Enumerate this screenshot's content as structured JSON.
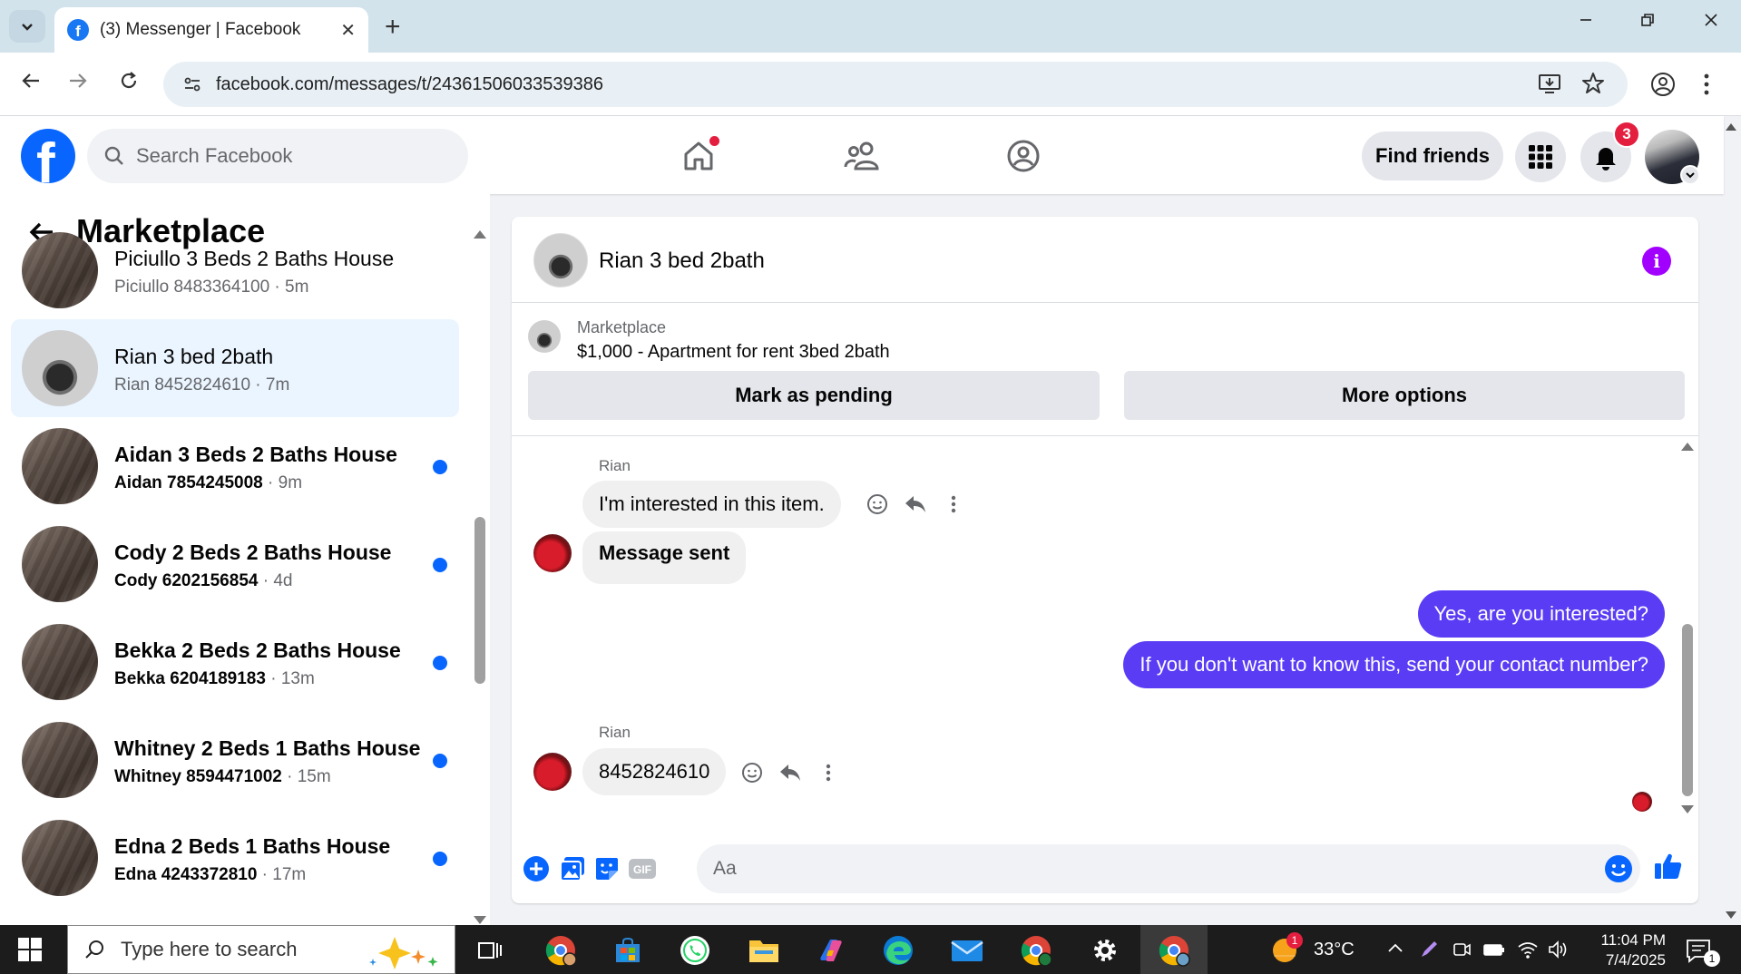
{
  "browser": {
    "tab_title": "(3) Messenger | Facebook",
    "url": "facebook.com/messages/t/24361506033539386",
    "new_tab_label": "+",
    "tab_close_label": "✕"
  },
  "header": {
    "logo_letter": "f",
    "search_placeholder": "Search Facebook",
    "find_friends_label": "Find friends",
    "notification_count": "3"
  },
  "sidebar": {
    "title": "Marketplace",
    "conversations": [
      {
        "name": "Piciullo 3 Beds 2 Baths House",
        "contact": "Piciullo 8483364100",
        "time": "5m",
        "unread": false,
        "active": false
      },
      {
        "name": "Rian 3 bed 2bath",
        "contact": "Rian 8452824610",
        "time": "7m",
        "unread": false,
        "active": true
      },
      {
        "name": "Aidan 3 Beds 2 Baths House",
        "contact": "Aidan 7854245008",
        "time": "9m",
        "unread": true,
        "active": false
      },
      {
        "name": "Cody 2 Beds 2 Baths House",
        "contact": "Cody 6202156854",
        "time": "4d",
        "unread": true,
        "active": false
      },
      {
        "name": "Bekka 2 Beds 2 Baths House",
        "contact": "Bekka 6204189183",
        "time": "13m",
        "unread": true,
        "active": false
      },
      {
        "name": "Whitney 2 Beds 1 Baths House",
        "contact": "Whitney 8594471002",
        "time": "15m",
        "unread": true,
        "active": false
      },
      {
        "name": "Edna 2 Beds 1 Baths House",
        "contact": "Edna 4243372810",
        "time": "17m",
        "unread": true,
        "active": false
      }
    ]
  },
  "chat": {
    "contact_name": "Rian 3 bed 2bath",
    "listing": {
      "source": "Marketplace",
      "title": "$1,000 - Apartment for rent 3bed 2bath",
      "mark_pending_label": "Mark as pending",
      "more_options_label": "More options"
    },
    "messages": [
      {
        "from": "Rian",
        "direction": "in",
        "text": "I'm interested in this item."
      },
      {
        "from": "",
        "direction": "in",
        "text": "Message sent"
      },
      {
        "from": "me",
        "direction": "out",
        "text": "Yes, are you interested?"
      },
      {
        "from": "me",
        "direction": "out",
        "text": "If you don't want to know this, send your contact number?"
      },
      {
        "from": "Rian",
        "direction": "in",
        "text": "8452824610"
      }
    ],
    "composer_placeholder": "Aa",
    "gif_label": "GIF"
  },
  "taskbar": {
    "search_placeholder": "Type here to search",
    "temperature": "33°C",
    "weather_badge": "1",
    "time": "11:04 PM",
    "date": "7/4/2025",
    "notification_count": "1"
  },
  "colors": {
    "facebook_blue": "#0866ff",
    "outgoing_bubble": "#5b3cf5",
    "notification_red": "#e41e3f",
    "info_purple": "#a100ff"
  }
}
